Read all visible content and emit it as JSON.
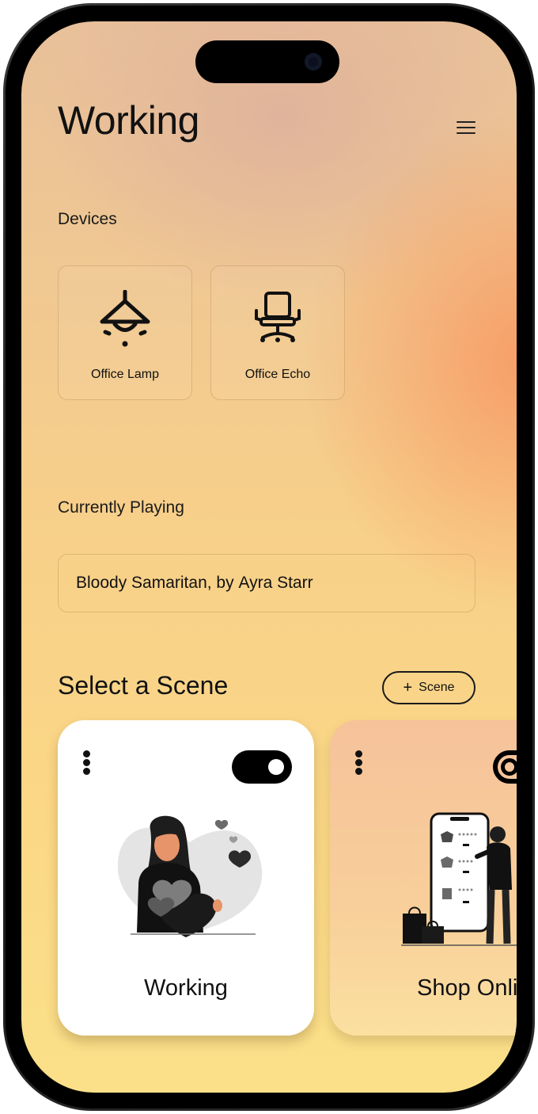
{
  "header": {
    "title": "Working",
    "menu_icon": "hamburger-menu-icon"
  },
  "devices": {
    "label": "Devices",
    "items": [
      {
        "label": "Office Lamp",
        "icon": "ceiling-lamp-icon"
      },
      {
        "label": "Office Echo",
        "icon": "office-chair-icon"
      }
    ]
  },
  "now_playing": {
    "label": "Currently Playing",
    "song": "Bloody Samaritan",
    "separator": ", by ",
    "artist": "Ayra Starr"
  },
  "scenes": {
    "heading": "Select a Scene",
    "add_label": "Scene",
    "items": [
      {
        "name": "Working",
        "enabled": true,
        "illustration": "woman-holding-heart-illustration"
      },
      {
        "name": "Shop Online",
        "enabled": false,
        "illustration": "woman-shopping-phone-illustration"
      }
    ]
  },
  "colors": {
    "accent": "#000000",
    "card_white": "#ffffff",
    "gradient_peach": "#f8965f",
    "gradient_yellow": "#fbd886"
  }
}
